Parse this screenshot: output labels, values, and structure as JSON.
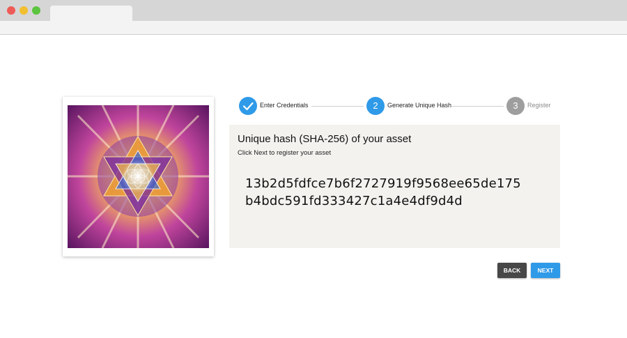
{
  "stepper": {
    "steps": [
      {
        "label": "Enter Credentials",
        "state": "done",
        "icon": "check-icon"
      },
      {
        "label": "Generate Unique Hash",
        "number": "2",
        "state": "active"
      },
      {
        "label": "Register",
        "number": "3",
        "state": "pending"
      }
    ]
  },
  "hash_panel": {
    "title": "Unique hash (SHA-256) of your asset",
    "subtitle": "Click Next to register your asset",
    "hash_lines": [
      "13b2d5fdfce7b6f2727919f9568ee65de175",
      "b4bdc591fd333427c1a4e4df9d4d"
    ]
  },
  "actions": {
    "back_label": "BACK",
    "next_label": "NEXT"
  },
  "colors": {
    "accent": "#2f9ae8",
    "pending": "#9e9e9e",
    "back_button": "#474747",
    "panel_bg": "#f3f2ef"
  }
}
